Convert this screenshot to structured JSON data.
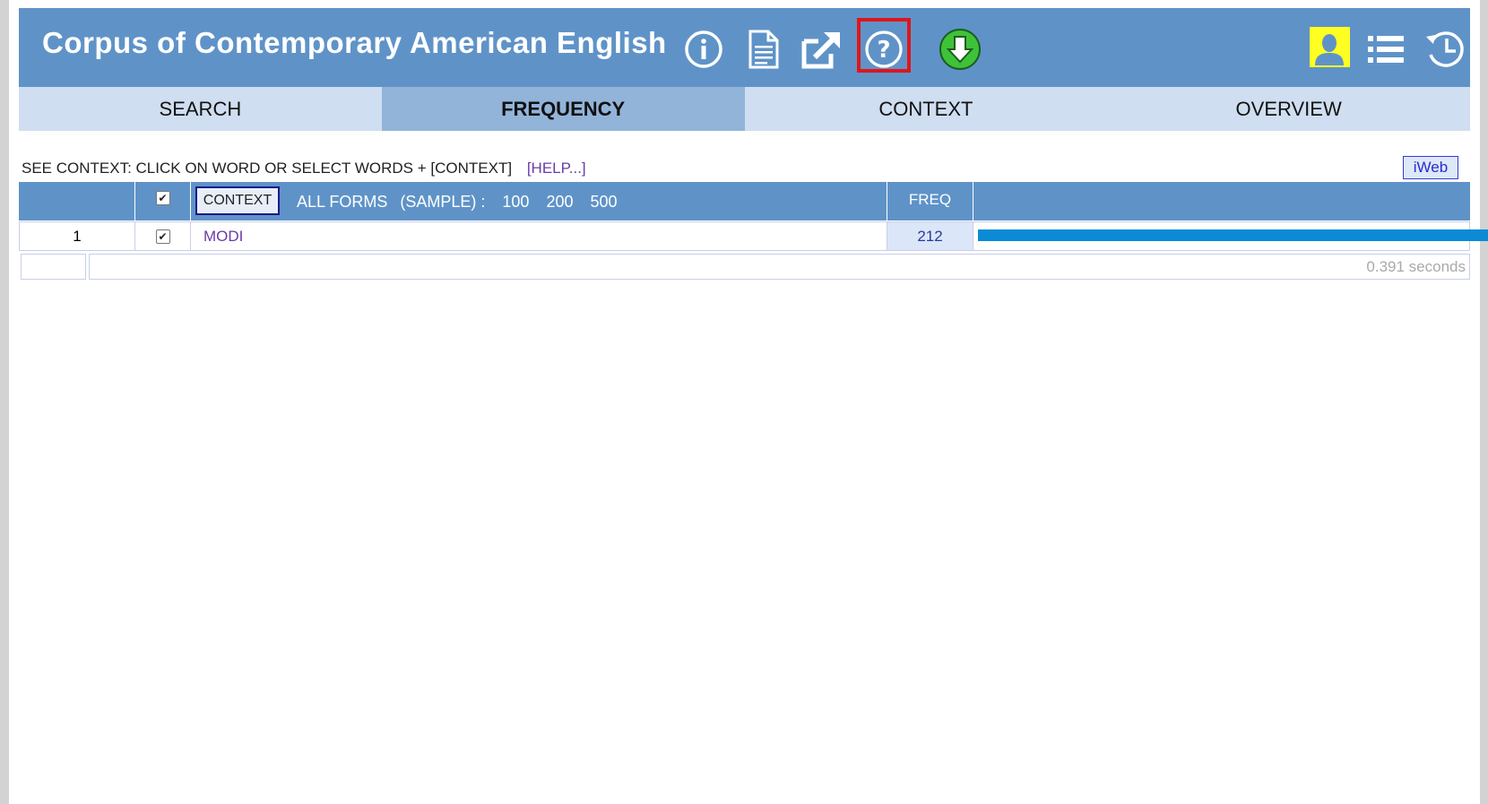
{
  "app": {
    "title": "Corpus of Contemporary American English"
  },
  "header_icons": [
    "info-icon",
    "document-icon",
    "external-link-icon",
    "help-icon",
    "download-icon",
    "user-icon",
    "list-icon",
    "history-icon"
  ],
  "colors": {
    "header_bg": "#5f93c8",
    "tab_bg": "#cfdef0",
    "tab_active_bg": "#92b4d9",
    "highlight_red": "#e0151a",
    "user_yellow": "#ffff22",
    "download_green": "#3fc23a",
    "bar_blue": "#0b8bd6",
    "link_purple": "#6a3aa8"
  },
  "tabs": [
    {
      "label": "SEARCH",
      "active": false
    },
    {
      "label": "FREQUENCY",
      "active": true
    },
    {
      "label": "CONTEXT",
      "active": false
    },
    {
      "label": "OVERVIEW",
      "active": false
    }
  ],
  "info": {
    "text": "SEE CONTEXT: CLICK ON WORD OR SELECT WORDS + [CONTEXT]",
    "help_link": "[HELP...]",
    "iweb_label": "iWeb"
  },
  "table": {
    "context_button": "CONTEXT",
    "all_forms_label": "ALL FORMS",
    "sample_label": "(SAMPLE) :",
    "sample_options": [
      "100",
      "200",
      "500"
    ],
    "freq_header": "FREQ",
    "rows": [
      {
        "rank": "1",
        "checked": true,
        "word": "MODI",
        "freq": "212",
        "bar_fraction": 1.0
      }
    ],
    "timing": "0.391 seconds"
  }
}
